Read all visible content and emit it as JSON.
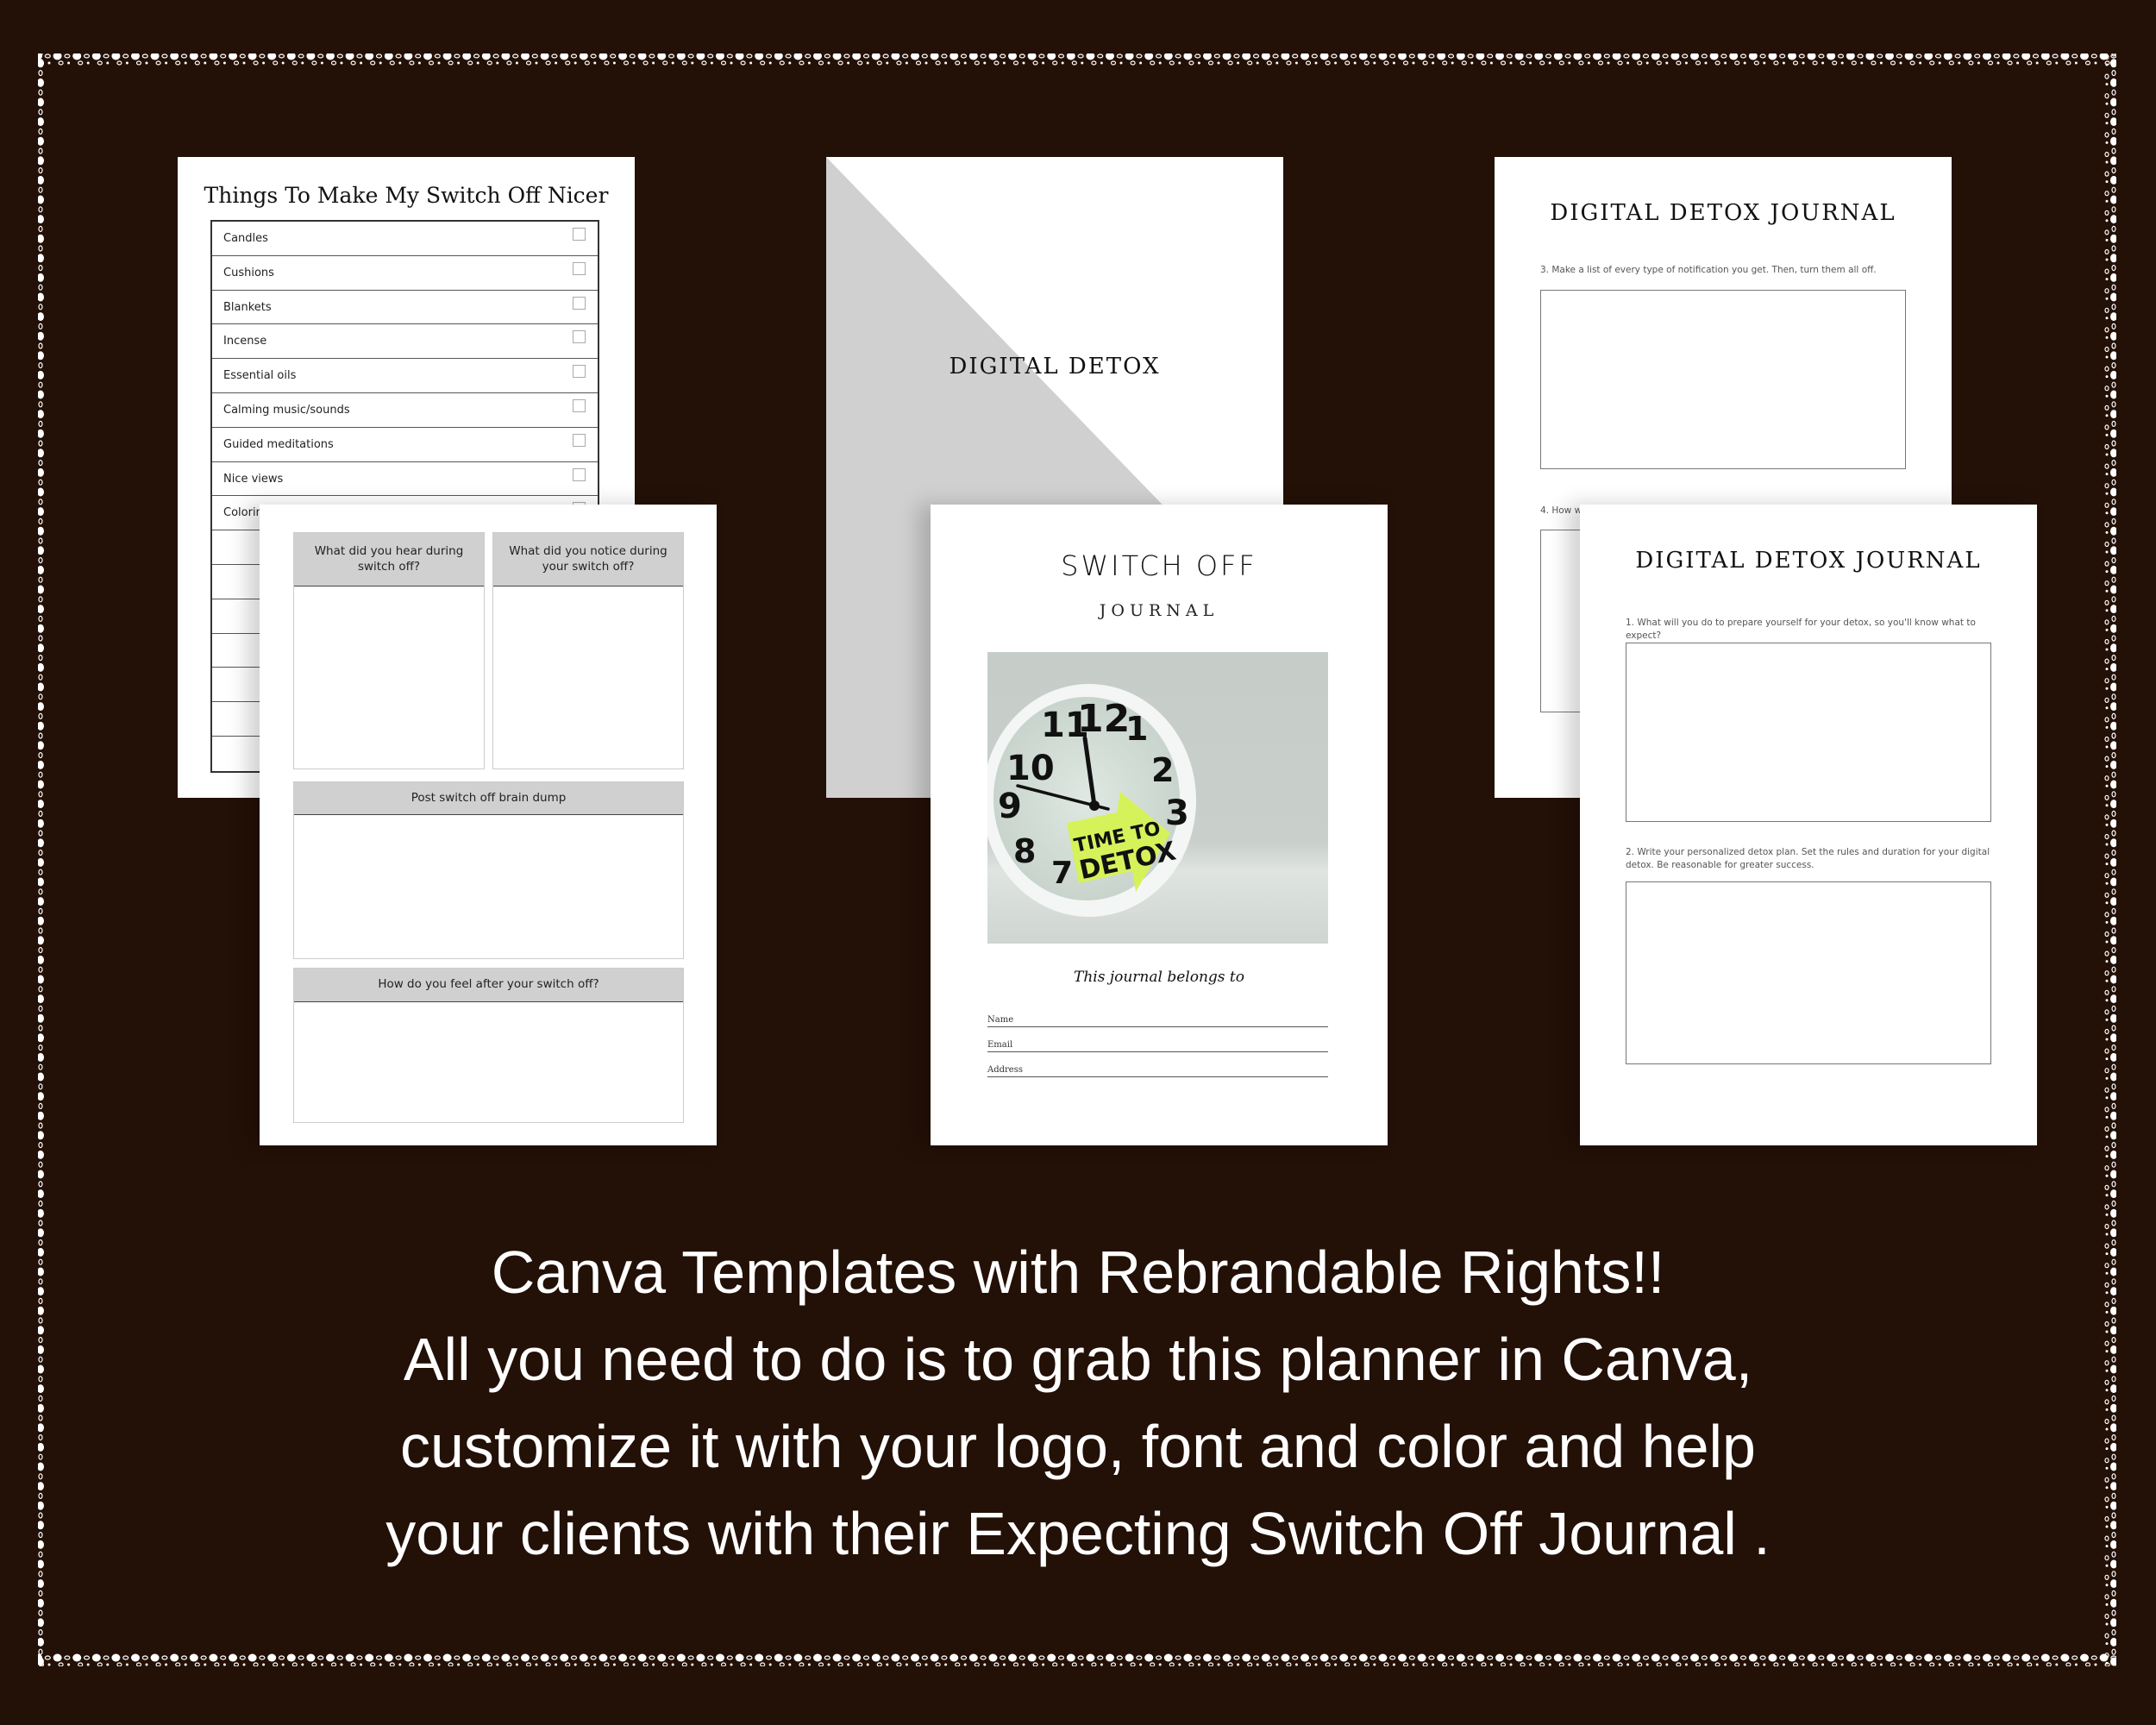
{
  "colors": {
    "background": "#231006",
    "frame_dots": "#ffffff",
    "page": "#ffffff",
    "header_gray": "#d0d0d0",
    "cover_gray": "#d0d0d0",
    "sticky_note": "#d6f25a",
    "caption_text": "#ffffff"
  },
  "checklist_page": {
    "title": "Things To Make My Switch Off Nicer",
    "items": [
      {
        "label": "Candles",
        "checked": false
      },
      {
        "label": "Cushions",
        "checked": false
      },
      {
        "label": "Blankets",
        "checked": false
      },
      {
        "label": "Incense",
        "checked": false
      },
      {
        "label": "Essential oils",
        "checked": false
      },
      {
        "label": "Calming music/sounds",
        "checked": false
      },
      {
        "label": "Guided meditations",
        "checked": false
      },
      {
        "label": "Nice views",
        "checked": false
      },
      {
        "label": "Coloring books/doodle pads",
        "checked": false
      },
      {
        "label": "",
        "checked": false
      },
      {
        "label": "",
        "checked": false
      },
      {
        "label": "",
        "checked": false
      },
      {
        "label": "",
        "checked": false
      },
      {
        "label": "",
        "checked": false
      },
      {
        "label": "",
        "checked": false
      },
      {
        "label": "",
        "checked": false
      }
    ]
  },
  "reflection_page": {
    "sections": [
      {
        "heading": "What did you hear during switch off?"
      },
      {
        "heading": "What did you notice during your switch off?"
      },
      {
        "heading": "Post switch off brain dump"
      },
      {
        "heading": "How do you feel after your switch off?"
      }
    ]
  },
  "digital_detox_cover": {
    "title": "DIGITAL DETOX"
  },
  "switch_off_cover": {
    "title": "SWITCH OFF",
    "subtitle": "JOURNAL",
    "photo": {
      "sticky_line1": "TIME TO",
      "sticky_line2": "DETOX",
      "clock_numbers": [
        "12",
        "1",
        "2",
        "3",
        "7",
        "8",
        "9",
        "10",
        "11"
      ]
    },
    "belongs_to": "This journal belongs to",
    "fields": [
      "Name",
      "Email",
      "Address"
    ]
  },
  "journal_page_back": {
    "title": "DIGITAL DETOX JOURNAL",
    "prompts": [
      "3. Make a list of every type of notification you get. Then, turn them all off.",
      "4. How wi"
    ]
  },
  "journal_page_front": {
    "title": "DIGITAL DETOX JOURNAL",
    "prompts": [
      "1. What will you do to prepare yourself for your detox, so you'll know what to expect?",
      "2. Write your personalized detox plan. Set the rules and duration for your digital detox. Be reasonable for greater success."
    ]
  },
  "caption": {
    "lines": [
      "Canva Templates with Rebrandable Rights!!",
      "All you need to do is to grab this planner in Canva,",
      "customize it with your logo, font and color and help",
      "your clients with their Expecting Switch Off Journal ."
    ]
  }
}
